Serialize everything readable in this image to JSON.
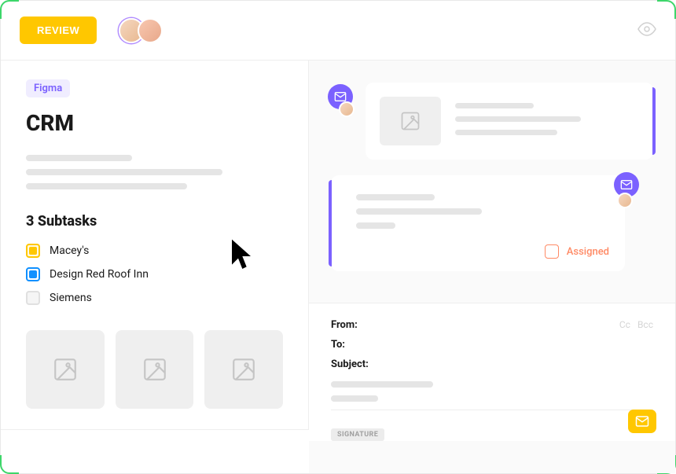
{
  "header": {
    "review_label": "REVIEW"
  },
  "left": {
    "tag": "Figma",
    "title": "CRM",
    "subtasks_title": "3 Subtasks",
    "subtasks": [
      {
        "label": "Macey's",
        "color": "yellow"
      },
      {
        "label": "Design Red Roof Inn",
        "color": "blue"
      },
      {
        "label": "Siemens",
        "color": "grey"
      }
    ]
  },
  "right": {
    "assigned_label": "Assigned"
  },
  "compose": {
    "from_label": "From:",
    "to_label": "To:",
    "subject_label": "Subject:",
    "cc_label": "Cc",
    "bcc_label": "Bcc",
    "signature_label": "SIGNATURE"
  }
}
